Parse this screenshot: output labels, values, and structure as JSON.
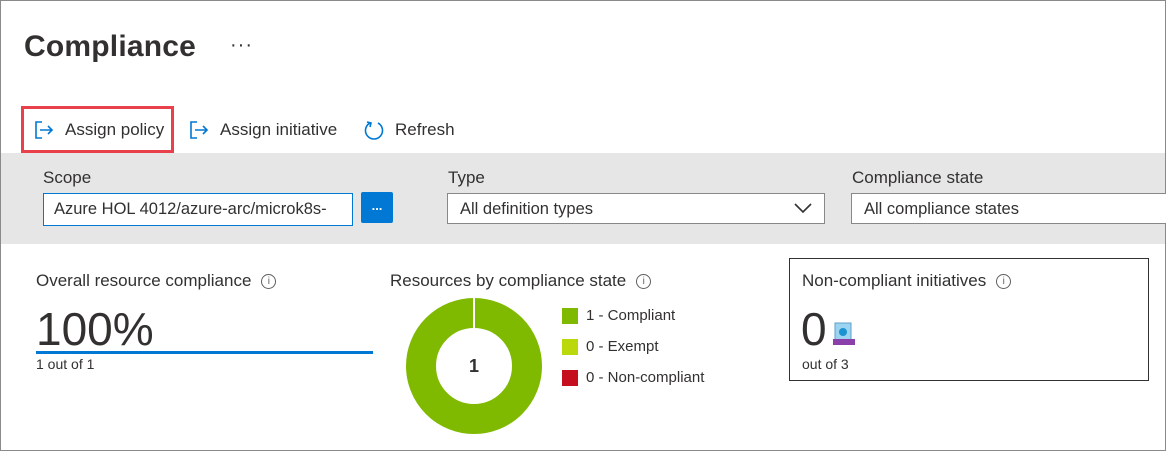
{
  "page": {
    "title": "Compliance",
    "more": "···"
  },
  "toolbar": {
    "assign_policy": "Assign policy",
    "assign_initiative": "Assign initiative",
    "refresh": "Refresh"
  },
  "filters": {
    "scope": {
      "label": "Scope",
      "value": "Azure HOL 4012/azure-arc/microk8s-",
      "button": "..."
    },
    "type": {
      "label": "Type",
      "value": "All definition types"
    },
    "compliance_state": {
      "label": "Compliance state",
      "value": "All compliance states"
    }
  },
  "overall": {
    "title": "Overall resource compliance",
    "value": "100%",
    "sub": "1 out of 1"
  },
  "by_state": {
    "title": "Resources by compliance state",
    "center": "1",
    "legend": [
      {
        "label": "1 - Compliant",
        "color": "#7fba00"
      },
      {
        "label": "0 - Exempt",
        "color": "#bad80a"
      },
      {
        "label": "0 - Non-compliant",
        "color": "#c50f1f"
      }
    ]
  },
  "non_compliant": {
    "title": "Non-compliant initiatives",
    "value": "0",
    "sub": "out of 3"
  },
  "chart_data": {
    "type": "pie",
    "categories": [
      "Compliant",
      "Exempt",
      "Non-compliant"
    ],
    "values": [
      1,
      0,
      0
    ],
    "colors": [
      "#7fba00",
      "#bad80a",
      "#c50f1f"
    ]
  },
  "info_icon": "i"
}
